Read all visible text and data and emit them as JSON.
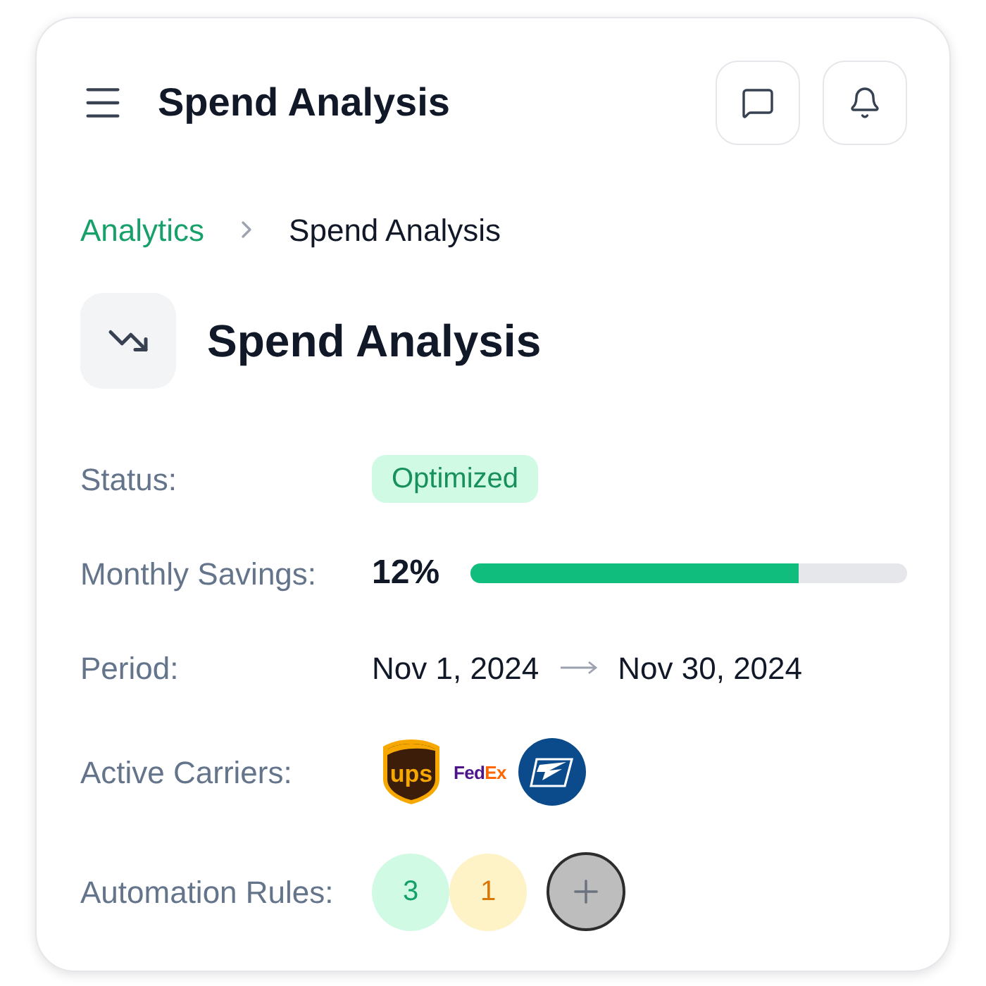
{
  "header": {
    "title": "Spend Analysis"
  },
  "breadcrumb": [
    {
      "label": "Analytics",
      "current": false
    },
    {
      "label": "Spend Analysis",
      "current": true
    }
  ],
  "page": {
    "title": "Spend Analysis"
  },
  "details": [
    {
      "kind": "badge",
      "label": "Status:",
      "value": "Optimized"
    },
    {
      "kind": "progress",
      "label": "Monthly Savings:",
      "value": "12%",
      "level": 0.75
    },
    {
      "kind": "range",
      "label": "Period:",
      "start": "Nov 1, 2024",
      "end": "Nov 30, 2024"
    },
    {
      "kind": "carriers",
      "label": "Active Carriers:",
      "carriers": [
        {
          "kind": "shield",
          "text": "ups"
        },
        {
          "kind": "wordmark",
          "parts": [
            "Fed",
            "Ex"
          ]
        },
        {
          "kind": "disc"
        }
      ]
    },
    {
      "kind": "rules",
      "label": "Automation Rules:",
      "counts": [
        {
          "kind": "success",
          "value": "3"
        },
        {
          "kind": "warning",
          "value": "1"
        }
      ]
    }
  ]
}
